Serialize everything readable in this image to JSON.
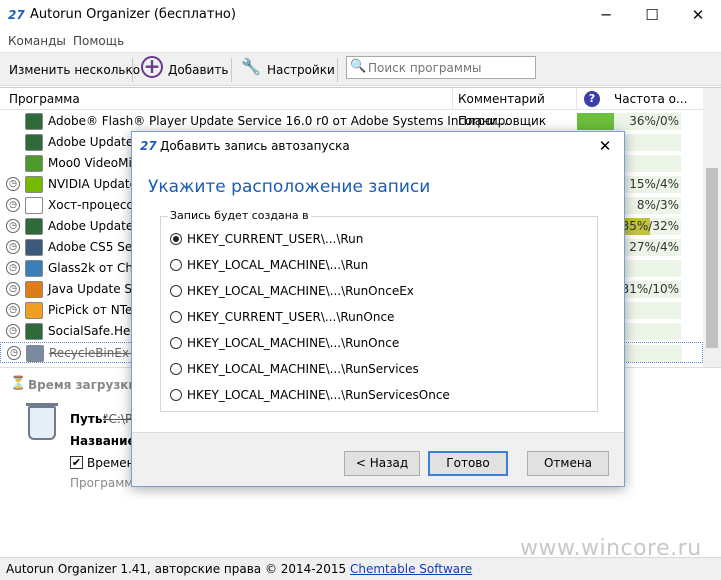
{
  "window": {
    "title": "Autorun Organizer (бесплатно)",
    "minimize": "─",
    "maximize": "☐",
    "close": "✕"
  },
  "menu": [
    "Команды",
    "Помощь"
  ],
  "toolbar": {
    "change_several": "Изменить несколько",
    "add": "Добавить",
    "settings": "Настройки",
    "search_placeholder": "Поиск программы"
  },
  "list": {
    "columns": {
      "program": "Программа",
      "comment": "Комментарий",
      "frequency": "Частота о..."
    },
    "rows": [
      {
        "name": "Adobe® Flash® Player Update Service 16.0 r0 от Adobe Systems Incorpor...",
        "comment": "Планировщик",
        "freq": "36%/0%",
        "fill": 0.36,
        "fill_color": "#6cbf3c",
        "icon": "app-window-icon",
        "icon_color": "#2f6b3a",
        "clock": false
      },
      {
        "name": "Adobe Updater",
        "comment": "",
        "freq": "",
        "fill": 0,
        "fill_color": "#6cbf3c",
        "icon": "app-window-icon",
        "icon_color": "#2f6b3a",
        "clock": false
      },
      {
        "name": "Moo0 VideoMin",
        "comment": "",
        "freq": "",
        "fill": 0,
        "fill_color": "#6cbf3c",
        "icon": "paw-icon",
        "icon_color": "#4f9a2a",
        "clock": false
      },
      {
        "name": "NVIDIA Update",
        "comment": "",
        "freq": "15%/4%",
        "fill": 0,
        "fill_color": "#6cbf3c",
        "icon": "nvidia-icon",
        "icon_color": "#76b900",
        "clock": true
      },
      {
        "name": "Хост-процесс W",
        "comment": "",
        "freq": "8%/3%",
        "fill": 0,
        "fill_color": "#6cbf3c",
        "icon": "file-icon",
        "icon_color": "#ffffff",
        "clock": true
      },
      {
        "name": "Adobe Updater",
        "comment": "",
        "freq": "35%/32%",
        "fill": 0.7,
        "fill_color": "#bfc43c",
        "icon": "app-window-icon",
        "icon_color": "#2f6b3a",
        "clock": true
      },
      {
        "name": "Adobe CS5 Serv",
        "comment": "",
        "freq": "27%/4%",
        "fill": 0,
        "fill_color": "#6cbf3c",
        "icon": "app-window-icon",
        "icon_color": "#3d5a7a",
        "clock": true
      },
      {
        "name": "Glass2k от Chim",
        "comment": "",
        "freq": "",
        "fill": 0,
        "fill_color": "#6cbf3c",
        "icon": "magnifier-icon",
        "icon_color": "#3b7fb8",
        "clock": true
      },
      {
        "name": "Java Update Sch",
        "comment": "",
        "freq": "31%/10%",
        "fill": 0,
        "fill_color": "#6cbf3c",
        "icon": "java-icon",
        "icon_color": "#e07b1a",
        "clock": true
      },
      {
        "name": "PicPick от NTeW",
        "comment": "",
        "freq": "",
        "fill": 0,
        "fill_color": "#6cbf3c",
        "icon": "palette-icon",
        "icon_color": "#f0a020",
        "clock": true
      },
      {
        "name": "SocialSafe.Help",
        "comment": "",
        "freq": "",
        "fill": 0,
        "fill_color": "#6cbf3c",
        "icon": "app-window-icon",
        "icon_color": "#2f6b3a",
        "clock": true
      },
      {
        "name": "RecycleBinEx от",
        "comment": "",
        "freq": "",
        "fill": 0,
        "fill_color": "#6cbf3c",
        "icon": "recycle-bin-icon",
        "icon_color": "#7a8aa0",
        "clock": true,
        "selected": true
      }
    ]
  },
  "details": {
    "section_title": "Время загрузки с",
    "path_label": "Путь:",
    "path_value": "\"C:\\P",
    "name_label": "Название:",
    "checkbox_label": "Времен",
    "programs_label": "Программ"
  },
  "status": {
    "text": "Autorun Organizer 1.41, авторские права © 2014-2015 ",
    "link": "Chemtable Software"
  },
  "watermark": "www.wincore.ru",
  "dialog": {
    "title": "Добавить запись автозапуска",
    "heading": "Укажите расположение записи",
    "group_label": "Запись будет создана в",
    "options": [
      {
        "label": "HKEY_CURRENT_USER\\...\\Run",
        "checked": true
      },
      {
        "label": "HKEY_LOCAL_MACHINE\\...\\Run",
        "checked": false
      },
      {
        "label": "HKEY_LOCAL_MACHINE\\...\\RunOnceEx",
        "checked": false
      },
      {
        "label": "HKEY_CURRENT_USER\\...\\RunOnce",
        "checked": false
      },
      {
        "label": "HKEY_LOCAL_MACHINE\\...\\RunOnce",
        "checked": false
      },
      {
        "label": "HKEY_LOCAL_MACHINE\\...\\RunServices",
        "checked": false
      },
      {
        "label": "HKEY_LOCAL_MACHINE\\...\\RunServicesOnce",
        "checked": false
      }
    ],
    "back_label": "< Назад",
    "done_label": "Готово",
    "cancel_label": "Отмена",
    "close": "✕"
  }
}
